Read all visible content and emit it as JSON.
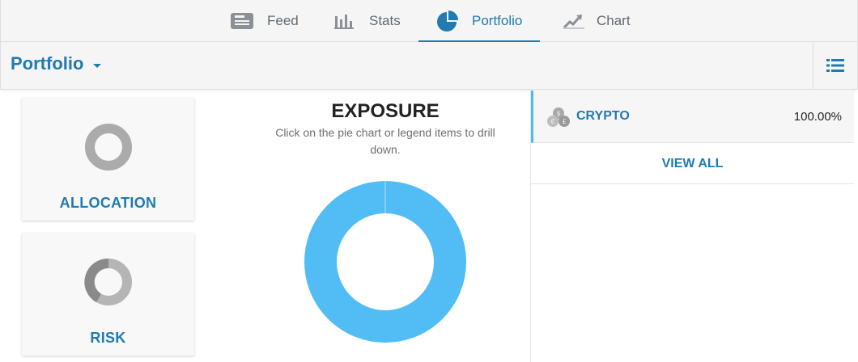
{
  "nav": {
    "tabs": [
      {
        "label": "Feed",
        "icon": "feed-icon"
      },
      {
        "label": "Stats",
        "icon": "stats-icon"
      },
      {
        "label": "Portfolio",
        "icon": "pie-chart-icon",
        "active": true
      },
      {
        "label": "Chart",
        "icon": "trend-chart-icon"
      }
    ]
  },
  "header": {
    "title": "Portfolio"
  },
  "cards": {
    "allocation": {
      "label": "ALLOCATION"
    },
    "risk": {
      "label": "RISK"
    }
  },
  "exposure": {
    "title": "EXPOSURE",
    "subtitle": "Click on the pie chart or legend items to drill down."
  },
  "chart_data": {
    "type": "pie",
    "categories": [
      "CRYPTO"
    ],
    "values": [
      100.0
    ],
    "colors": [
      "#52bcf5"
    ]
  },
  "legend": {
    "items": [
      {
        "name": "CRYPTO",
        "value": "100.00%",
        "icon": "coins-icon"
      }
    ],
    "view_all_label": "VIEW ALL"
  },
  "colors": {
    "accent": "#1f7bb0",
    "highlight": "#52b9f2"
  }
}
